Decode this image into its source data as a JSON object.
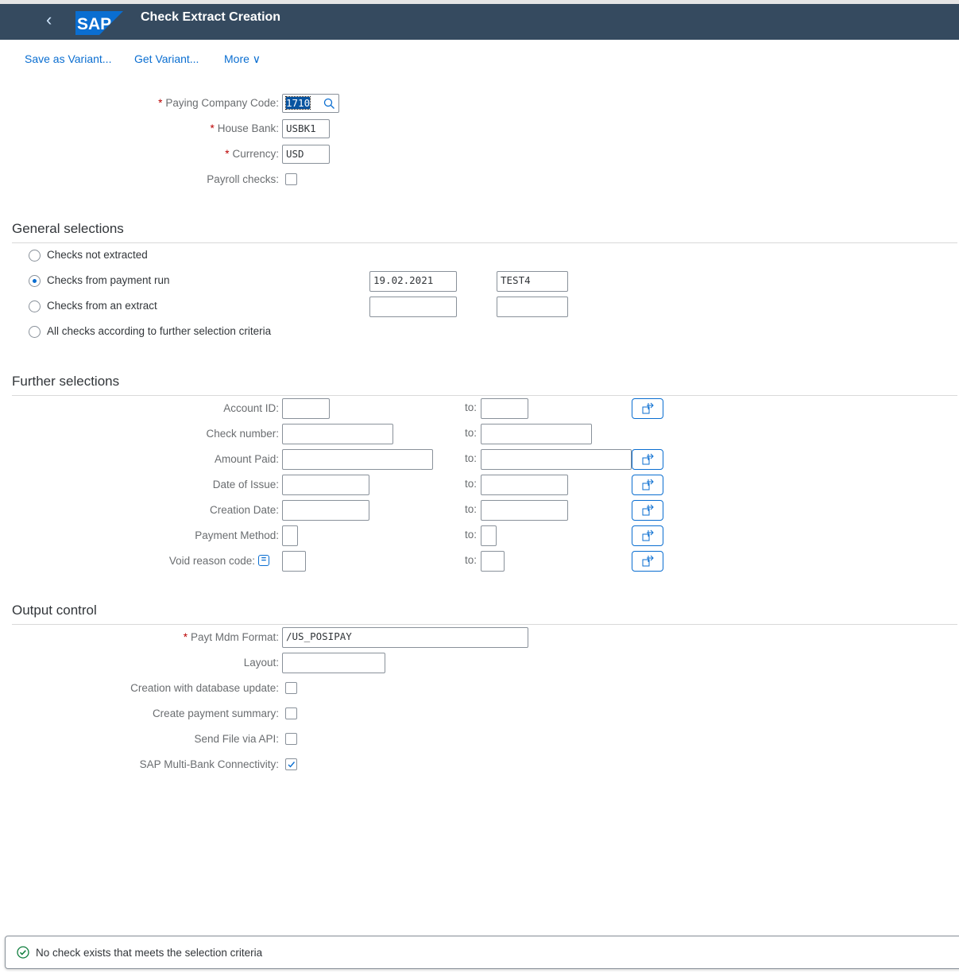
{
  "shell": {
    "title": "Check Extract Creation",
    "logo_text": "SAP",
    "back_icon": "chevron-left-icon",
    "bg": "#354a5f"
  },
  "toolbar": {
    "save_variant": "Save as Variant...",
    "get_variant": "Get Variant...",
    "more": "More"
  },
  "header_fields": [
    {
      "label": "Paying Company Code:",
      "value": "1710",
      "required": true
    },
    {
      "label": "House Bank:",
      "value": "USBK1",
      "required": true
    },
    {
      "label": "Currency:",
      "value": "USD",
      "required": true
    }
  ],
  "payroll": {
    "label": "Payroll checks:",
    "checked": false
  },
  "general": {
    "title": "General selections",
    "options": [
      {
        "label": "Checks not extracted",
        "selected": false
      },
      {
        "label": "Checks from payment run",
        "selected": true,
        "value1": "19.02.2021",
        "value2": "TEST4"
      },
      {
        "label": "Checks from an extract",
        "selected": false,
        "value1": "",
        "value2": ""
      },
      {
        "label": "All checks according to further selection criteria",
        "selected": false
      }
    ]
  },
  "further": {
    "title": "Further selections",
    "to_label": "to:",
    "rows": [
      {
        "label": "Account ID:",
        "from": "",
        "to": "",
        "multi": true
      },
      {
        "label": "Check number:",
        "from": "",
        "to": "",
        "multi": false
      },
      {
        "label": "Amount Paid:",
        "from": "",
        "to": "",
        "multi": true
      },
      {
        "label": "Date of Issue:",
        "from": "",
        "to": "",
        "multi": true
      },
      {
        "label": "Creation Date:",
        "from": "",
        "to": "",
        "multi": true
      },
      {
        "label": "Payment Method:",
        "from": "",
        "to": "",
        "multi": true
      },
      {
        "label": "Void reason code:",
        "from": "",
        "to": "",
        "multi": true
      }
    ]
  },
  "output": {
    "title": "Output control",
    "format": {
      "label": "Payt Mdm Format:",
      "value": "/US_POSIPAY",
      "required": true
    },
    "layout": {
      "label": "Layout:",
      "value": ""
    },
    "checks": [
      {
        "label": "Creation with database update:",
        "checked": false
      },
      {
        "label": "Create payment summary:",
        "checked": false
      },
      {
        "label": "Send File via API:",
        "checked": false
      },
      {
        "label": "SAP Multi-Bank Connectivity:",
        "checked": true
      }
    ]
  },
  "status": {
    "message": "No check exists that meets the selection criteria",
    "icon": "success-check-icon",
    "color": "#107e3e"
  }
}
